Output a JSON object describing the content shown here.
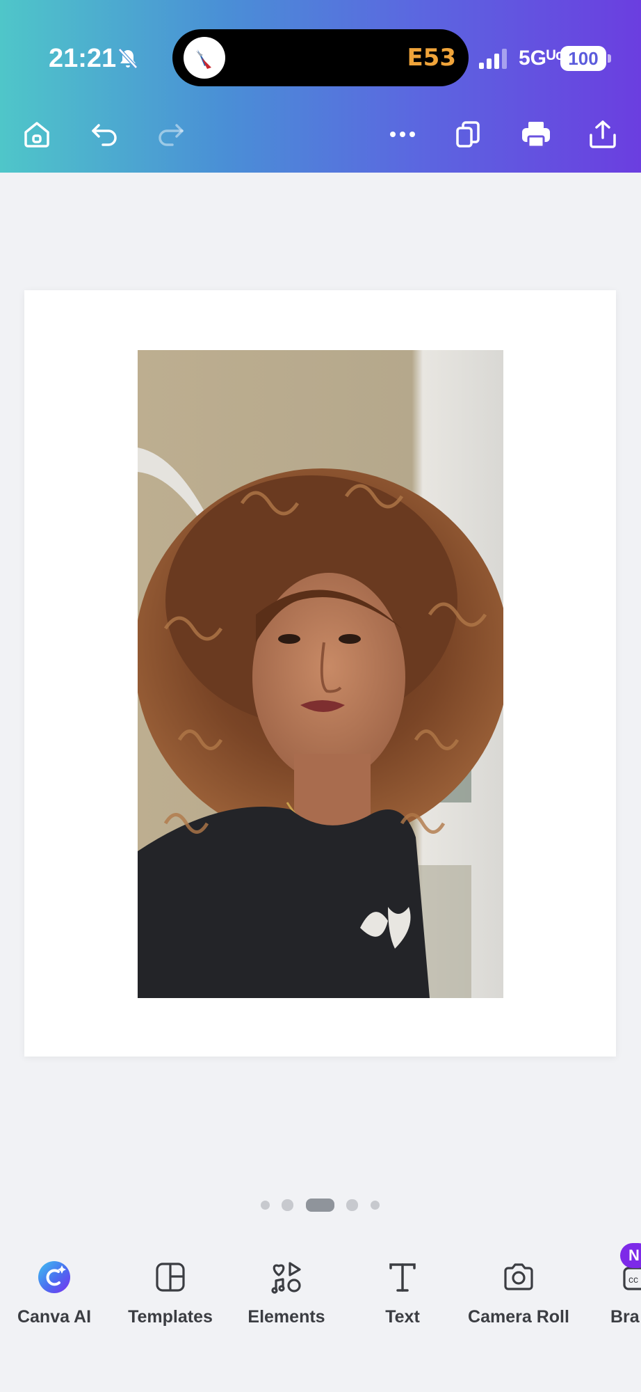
{
  "status_bar": {
    "time": "21:21",
    "activity_code": "E53",
    "network": "5Gᵁᶜ",
    "battery": "100"
  },
  "header_toolbar": {
    "icons": [
      "home-icon",
      "undo-icon",
      "redo-icon",
      "more-icon",
      "duplicate-page-icon",
      "print-icon",
      "share-icon"
    ]
  },
  "pagination": {
    "count": 5,
    "active_index": 2
  },
  "bottom_toolbar": {
    "items": [
      {
        "label": "Canva AI",
        "icon": "canva-ai-icon"
      },
      {
        "label": "Templates",
        "icon": "templates-icon"
      },
      {
        "label": "Elements",
        "icon": "elements-icon"
      },
      {
        "label": "Text",
        "icon": "text-icon"
      },
      {
        "label": "Camera Roll",
        "icon": "camera-icon"
      },
      {
        "label": "Bra",
        "icon": "brand-icon"
      }
    ],
    "badge": "N"
  },
  "colors": {
    "header_gradient": [
      "#4fc6c9",
      "#5b67e0",
      "#6b3ee0"
    ],
    "canvas_background": "#f1f2f5",
    "badge": "#7d2ae8",
    "activity_code": "#f0a43a"
  }
}
